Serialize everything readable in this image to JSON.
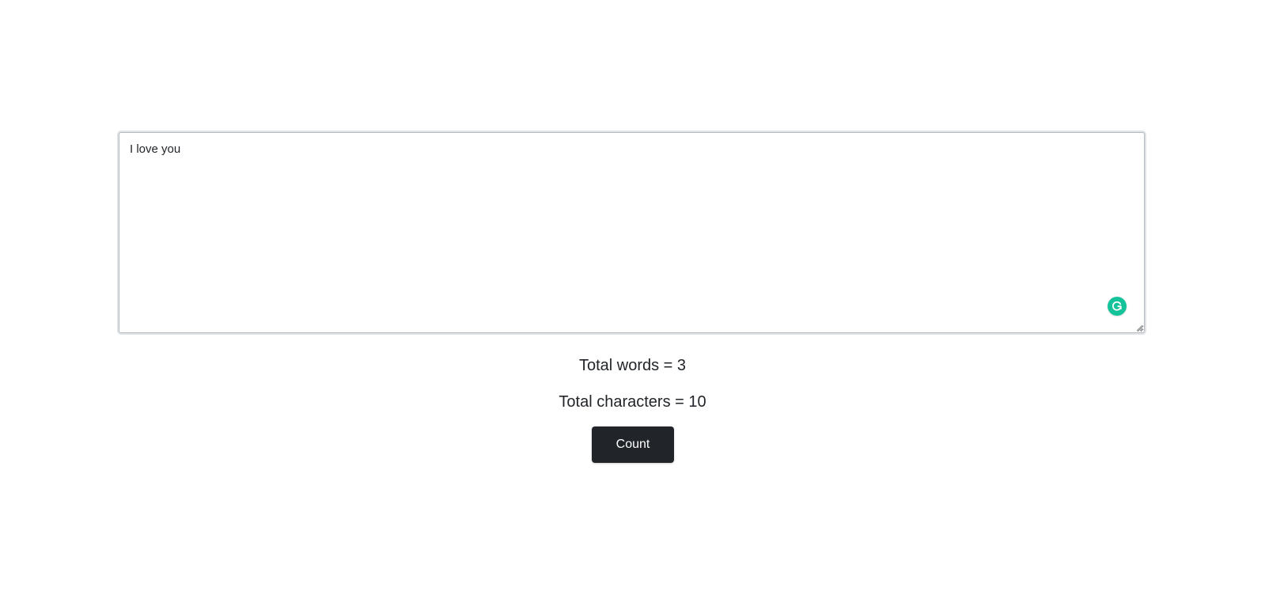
{
  "editor": {
    "value": "I love you",
    "grammarly_icon": "grammarly-g-icon",
    "grammarly_color": "#15c39a"
  },
  "results": {
    "words": "Total words = 3",
    "characters": "Total characters = 10"
  },
  "actions": {
    "count_label": "Count",
    "button_color": "#212529"
  }
}
